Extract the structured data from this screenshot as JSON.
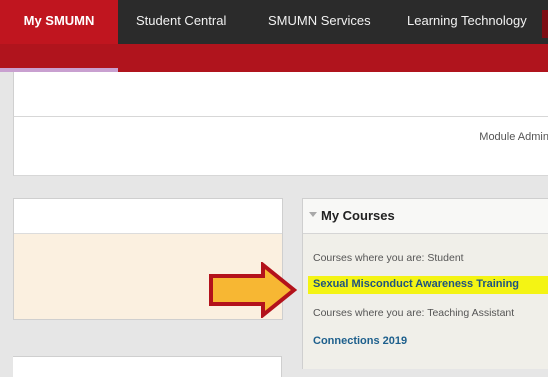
{
  "nav": {
    "tabs": [
      {
        "label": "My SMUMN",
        "active": true
      },
      {
        "label": "Student Central"
      },
      {
        "label": "SMUMN Services"
      },
      {
        "label": "Learning Technology"
      }
    ]
  },
  "admin": {
    "label": "Module Admin"
  },
  "my_courses": {
    "title": "My Courses",
    "student_heading": "Courses where you are: Student",
    "student_course": "Sexual Misconduct Awareness Training",
    "ta_heading": "Courses where you are: Teaching Assistant",
    "ta_course": "Connections 2019"
  },
  "colors": {
    "brand_red": "#b0141d",
    "active_tab": "#c0151f",
    "nav_dark": "#2b2b2b",
    "highlight": "#f4f414",
    "arrow_fill": "#f7b733",
    "arrow_border": "#b3121b",
    "link": "#1d5f8c"
  }
}
